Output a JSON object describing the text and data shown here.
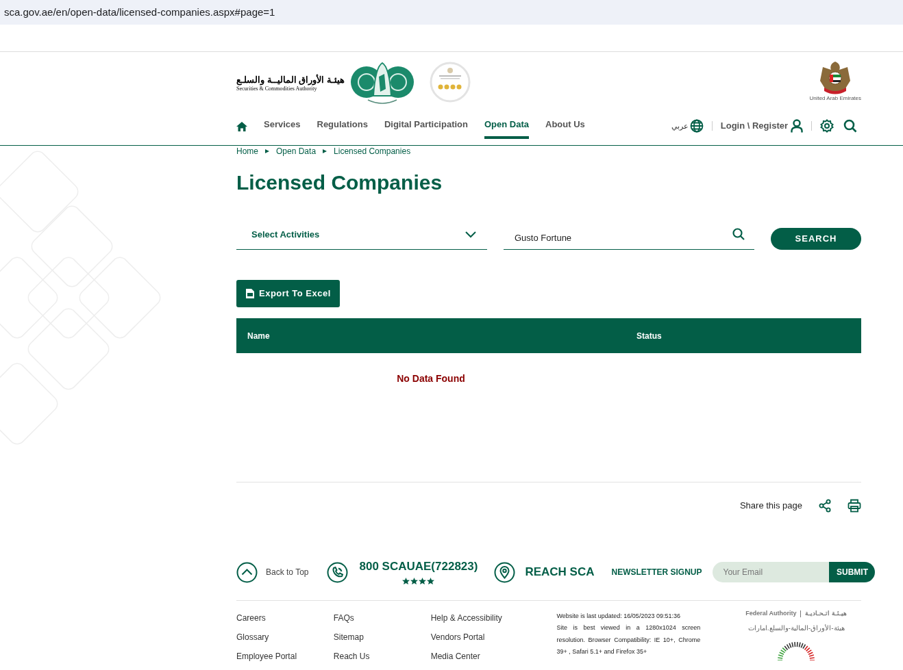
{
  "browser": {
    "url": "sca.gov.ae/en/open-data/licensed-companies.aspx#page=1"
  },
  "header": {
    "logo_arabic": "هيئـة الأوراق الماليــة والسلـع",
    "logo_english": "Securities & Commodities Authority",
    "emblem_caption": "United Arab Emirates",
    "language": "عربي",
    "login": "Login \\ Register"
  },
  "nav": {
    "items": [
      {
        "label": "Services",
        "selected": false
      },
      {
        "label": "Regulations",
        "selected": false
      },
      {
        "label": "Digital Participation",
        "selected": false
      },
      {
        "label": "Open Data",
        "selected": true
      },
      {
        "label": "About Us",
        "selected": false
      }
    ]
  },
  "breadcrumb": [
    "Home",
    "Open Data",
    "Licensed Companies"
  ],
  "page_title": "Licensed Companies",
  "filters": {
    "activity_select": {
      "placeholder": "Select Activities"
    },
    "search": {
      "value": "Gusto Fortune"
    },
    "search_button": "SEARCH"
  },
  "export_button": "Export To Excel",
  "table": {
    "columns": [
      "Name",
      "Status"
    ],
    "empty_message": "No Data Found"
  },
  "share_label": "Share this page",
  "footer_bar": {
    "back_to_top": "Back to Top",
    "phone": "800 SCAUAE(722823)",
    "stars": 4,
    "reach": "REACH SCA",
    "newsletter_label": "NEWSLETTER SIGNUP",
    "email_placeholder": "Your Email",
    "submit": "SUBMIT"
  },
  "footer_links": [
    [
      "Careers",
      "Glossary",
      "Employee Portal"
    ],
    [
      "FAQs",
      "Sitemap",
      "Reach Us"
    ],
    [
      "Help & Accessibility",
      "Vendors Portal",
      "Media Center"
    ]
  ],
  "footer_info": {
    "updated": "Website is last updated: 16/05/2023 09:51:36",
    "compatibility": "Site is best viewed in a 1280x1024 screen resolution. Browser Compatibility: IE 10+, Chrome 39+ , Safari 5.1+ and Firefox 35+"
  },
  "federal": {
    "english": "Federal Authority",
    "arabic": "هيـئـة اتـحـاديـة",
    "domain": "هيئة-الأوراق-المالية-والسلع.امارات"
  }
}
